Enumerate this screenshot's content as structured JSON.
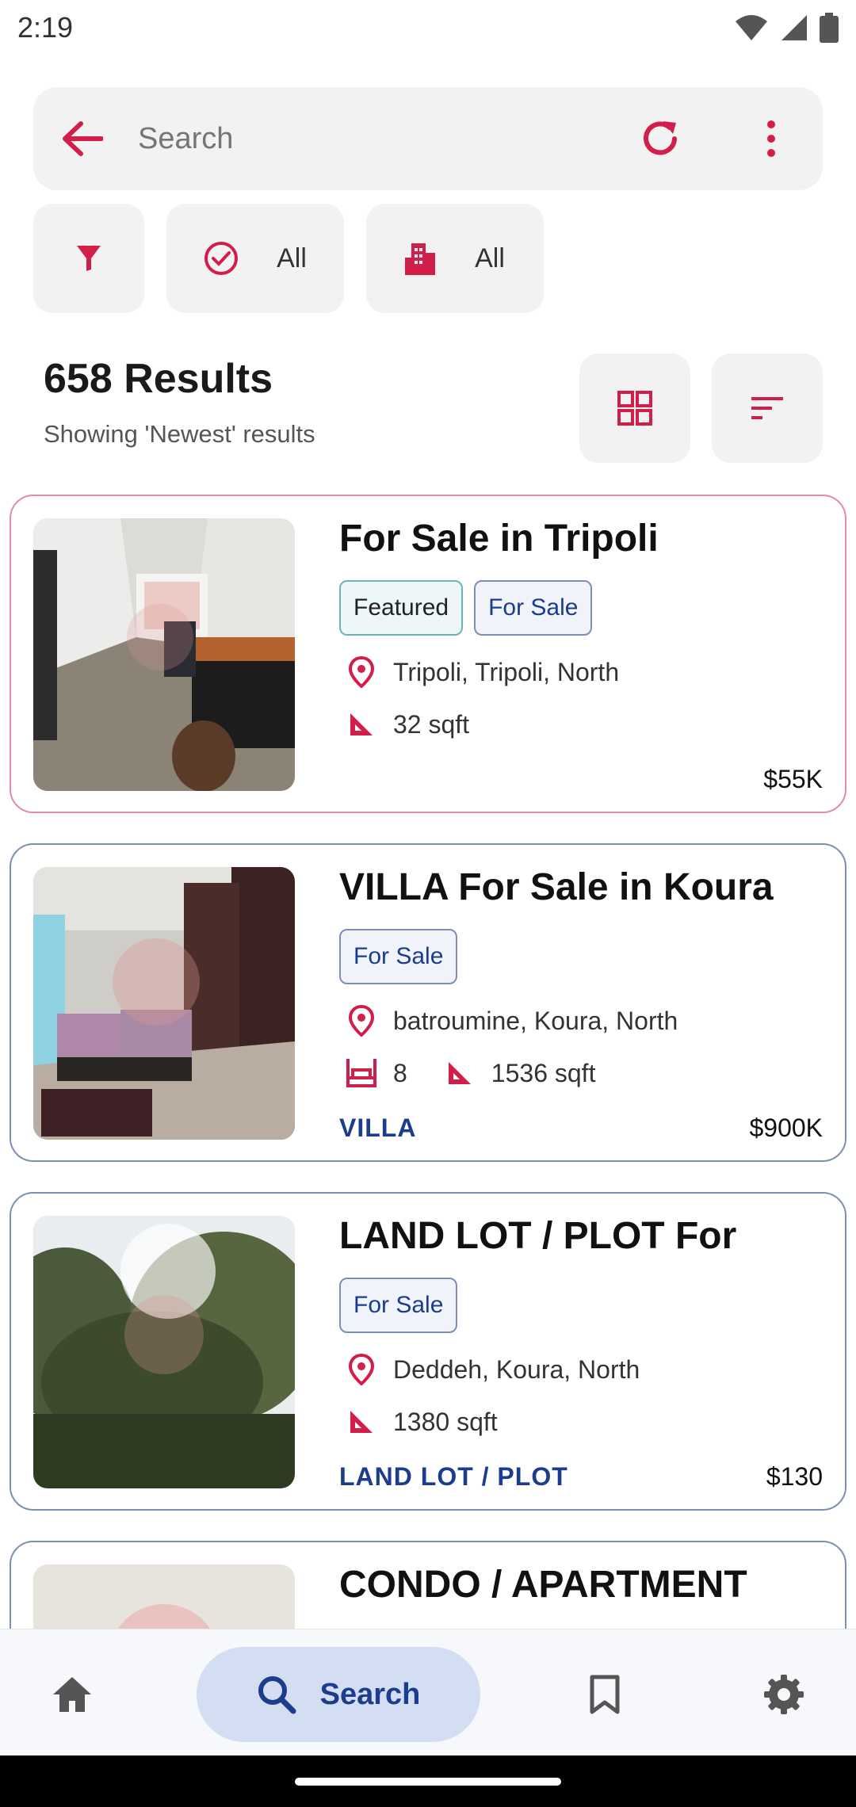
{
  "status": {
    "time": "2:19"
  },
  "search": {
    "placeholder": "Search"
  },
  "filters": {
    "status_chip": {
      "label": "All"
    },
    "type_chip": {
      "label": "All"
    }
  },
  "results": {
    "title": "658 Results",
    "subtitle": "Showing 'Newest' results"
  },
  "listings": [
    {
      "title": " For Sale in Tripoli",
      "tags": [
        "Featured",
        "For Sale"
      ],
      "location": "Tripoli, Tripoli, North",
      "bedrooms": "",
      "area": "32 sqft",
      "type": "",
      "price": "$55K"
    },
    {
      "title": "VILLA For Sale in Koura",
      "tags": [
        "For Sale"
      ],
      "location": "batroumine, Koura, North",
      "bedrooms": "8",
      "area": "1536 sqft",
      "type": "VILLA",
      "price": "$900K"
    },
    {
      "title": "LAND LOT / PLOT For",
      "tags": [
        "For Sale"
      ],
      "location": "Deddeh, Koura, North",
      "bedrooms": "",
      "area": "1380 sqft",
      "type": "LAND LOT / PLOT",
      "price": "$130"
    },
    {
      "title": "CONDO / APARTMENT"
    }
  ],
  "bottom_nav": {
    "search_label": "Search"
  },
  "colors": {
    "accent": "#d21e4b",
    "brand_blue": "#1c3c8c",
    "nav_pill": "#d3def3"
  },
  "icons": {
    "back": "arrow-left-icon",
    "refresh": "refresh-icon",
    "menu": "more-vertical-icon",
    "filter": "funnel-icon",
    "status": "check-circle-icon",
    "type": "building-icon",
    "grid": "grid-view-icon",
    "sort": "sort-icon",
    "location": "location-pin-icon",
    "area": "ruler-triangle-icon",
    "bed": "bed-icon",
    "home": "home-icon",
    "search": "search-icon",
    "saved": "bookmark-icon",
    "settings": "gear-icon"
  }
}
